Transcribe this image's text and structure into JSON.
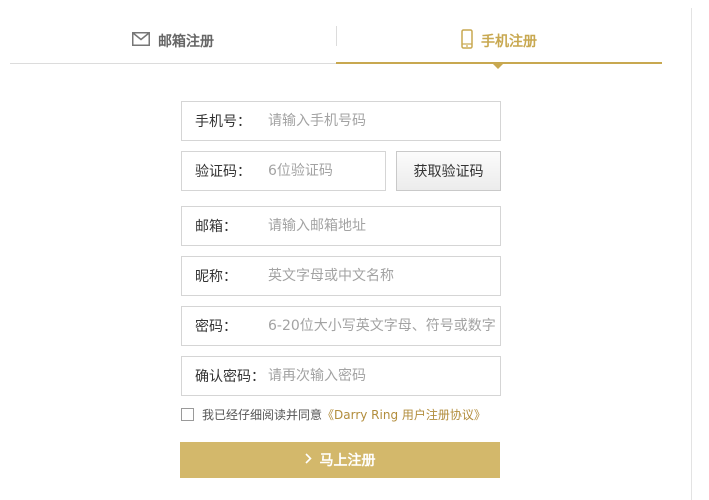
{
  "tabs": {
    "email_label": "邮箱注册",
    "phone_label": "手机注册",
    "active_color": "#c8a850"
  },
  "form": {
    "phone": {
      "label": "手机号：",
      "placeholder": "请输入手机号码"
    },
    "code": {
      "label": "验证码：",
      "placeholder": "6位验证码",
      "button": "获取验证码"
    },
    "email": {
      "label": "邮箱：",
      "placeholder": "请输入邮箱地址"
    },
    "nickname": {
      "label": "昵称：",
      "placeholder": "英文字母或中文名称"
    },
    "password": {
      "label": "密码：",
      "placeholder": "6-20位大小写英文字母、符号或数字"
    },
    "confirm": {
      "label": "确认密码：",
      "placeholder": "请再次输入密码"
    }
  },
  "agreement": {
    "text": "我已经仔细阅读并同意",
    "link": "《Darry Ring 用户注册协议》"
  },
  "submit": {
    "label": "马上注册",
    "color": "#d3b86b"
  },
  "icons": {
    "email_tab": "envelope-icon",
    "phone_tab": "mobile-phone-icon",
    "submit": "chevron-right-icon"
  }
}
